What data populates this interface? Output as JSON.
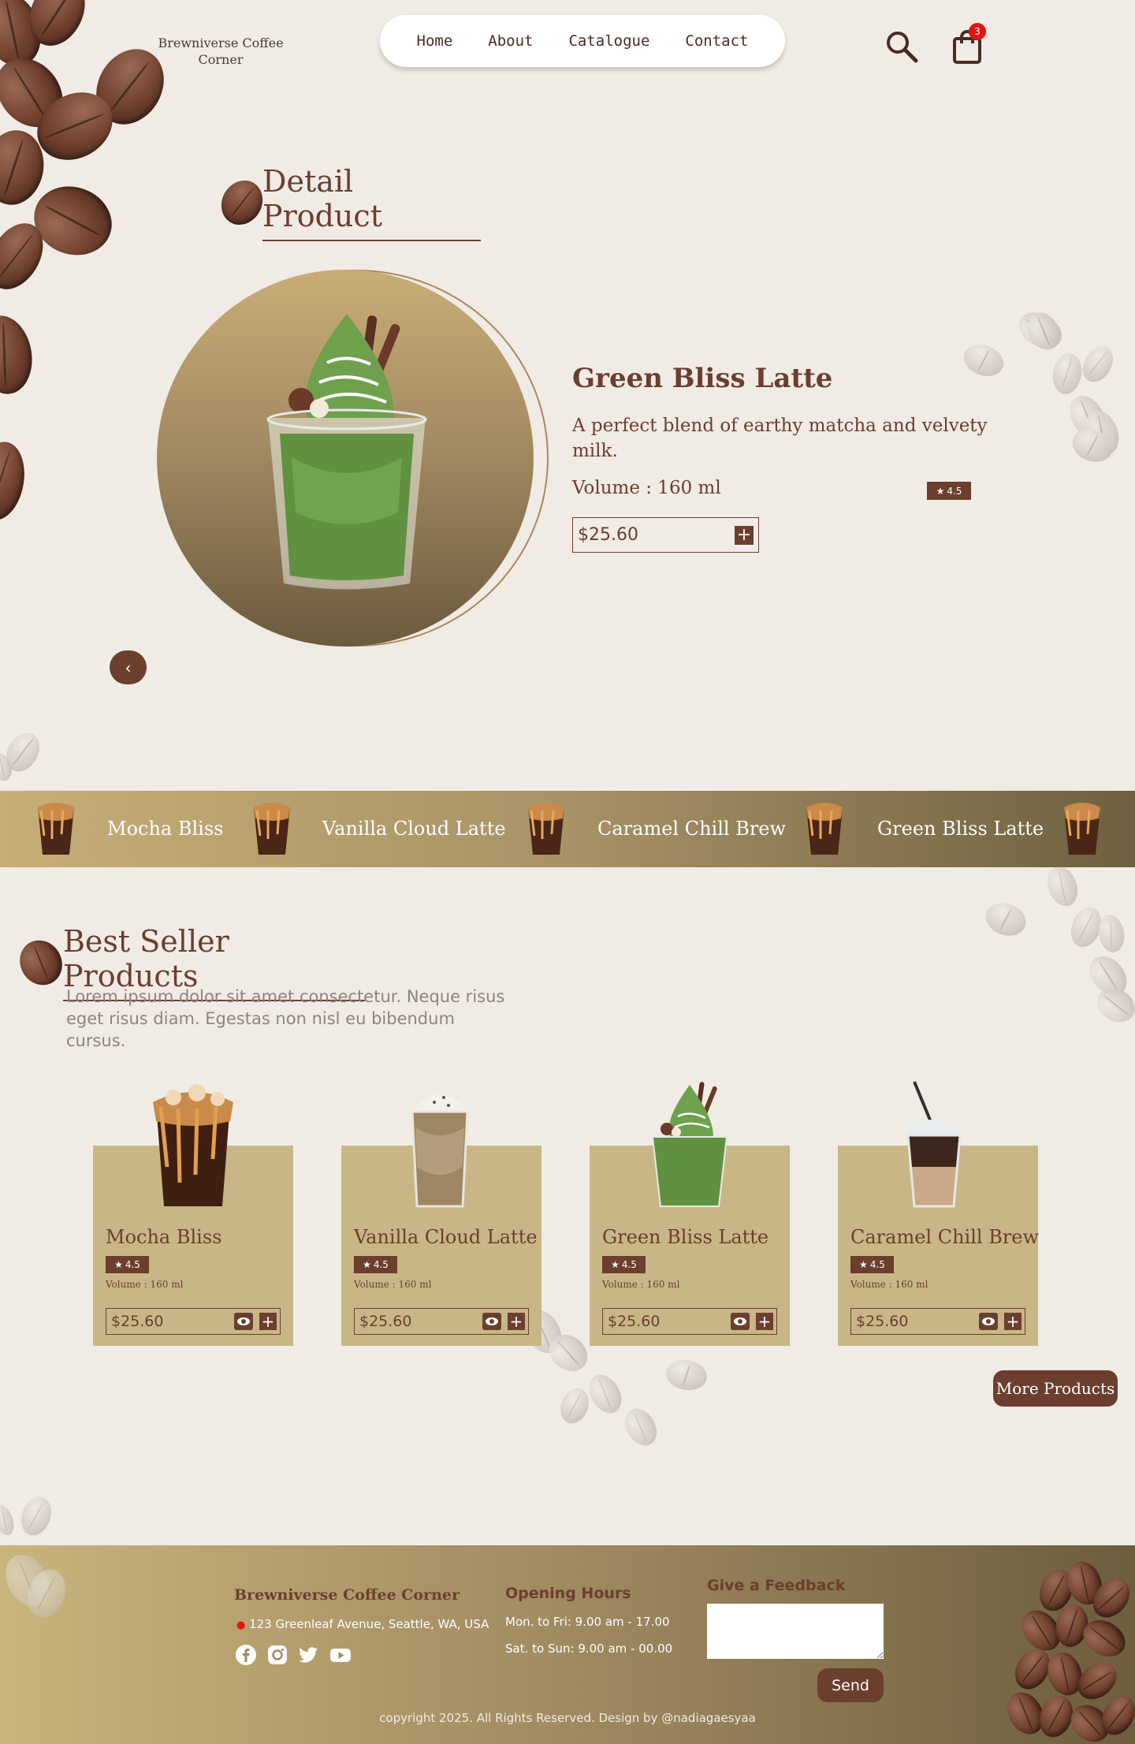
{
  "header": {
    "brand": "Brewniverse Coffee Corner",
    "nav": [
      "Home",
      "About",
      "Catalogue",
      "Contact"
    ],
    "cart_count": "3"
  },
  "detail": {
    "section_title": "Detail Product",
    "name": "Green Bliss Latte",
    "description": "A perfect blend of earthy matcha and velvety milk.",
    "volume": "Volume : 160 ml",
    "rating": "4.5",
    "price": "$25.60",
    "prev_symbol": "‹"
  },
  "band": {
    "items": [
      "Mocha Bliss",
      "Vanilla Cloud Latte",
      "Caramel Chill Brew",
      "Green Bliss Latte"
    ]
  },
  "best_seller": {
    "section_title": "Best Seller Products",
    "description": "Lorem ipsum dolor sit amet consectetur. Neque risus eget risus diam. Egestas non nisl eu bibendum cursus.",
    "products": [
      {
        "name": "Mocha Bliss",
        "rating": "4.5",
        "volume": "Volume : 160 ml",
        "price": "$25.60"
      },
      {
        "name": "Vanilla Cloud Latte",
        "rating": "4.5",
        "volume": "Volume : 160 ml",
        "price": "$25.60"
      },
      {
        "name": "Green Bliss Latte",
        "rating": "4.5",
        "volume": "Volume : 160 ml",
        "price": "$25.60"
      },
      {
        "name": "Caramel Chill Brew",
        "rating": "4.5",
        "volume": "Volume : 160 ml",
        "price": "$25.60"
      }
    ],
    "more_label": "More Products"
  },
  "footer": {
    "brand": "Brewniverse Coffee Corner",
    "address": "123 Greenleaf Avenue, Seattle, WA, USA",
    "hours_title": "Opening Hours",
    "hours": [
      "Mon. to Fri: 9.00 am - 17.00",
      "Sat. to Sun: 9.00 am - 00.00"
    ],
    "feedback_title": "Give a Feedback",
    "feedback_value": "",
    "send_label": "Send",
    "copyright": "copyright 2025. All Rights Reserved. Design by @nadiagaesyaa"
  },
  "colors": {
    "accent": "#6b3e2e",
    "background": "#f1ebe5",
    "card": "#c8b687",
    "badge": "#e11515"
  },
  "icons": [
    "search-icon",
    "shopping-bag-icon",
    "star-icon",
    "plus-icon",
    "eye-icon",
    "chevron-left-icon",
    "location-pin-icon",
    "facebook-icon",
    "instagram-icon",
    "twitter-icon",
    "youtube-icon"
  ]
}
